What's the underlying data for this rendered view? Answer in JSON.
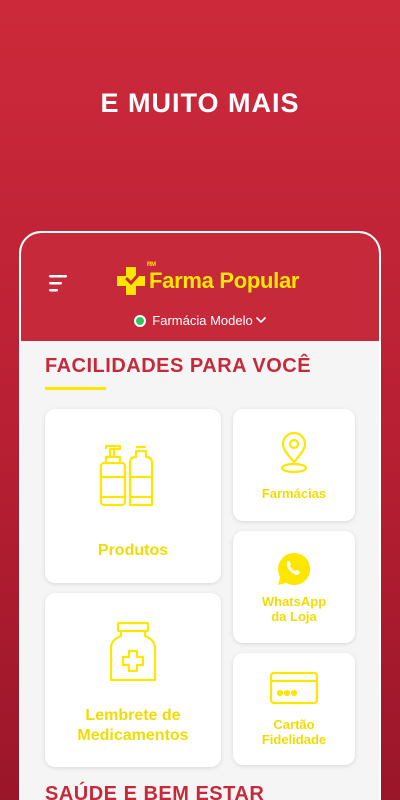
{
  "hero": {
    "title": "E MUITO MAIS"
  },
  "header": {
    "logo_rm": "RM",
    "logo_text": "Farma Popular",
    "store_name": "Farmácia Modelo"
  },
  "sections": [
    {
      "title": "FACILIDADES PARA VOCÊ"
    },
    {
      "title": "SAÚDE E BEM ESTAR"
    }
  ],
  "cards": {
    "produtos": {
      "label": "Produtos",
      "icon": "bottles-icon"
    },
    "farmacias": {
      "label": "Farmácias",
      "icon": "location-pin-icon"
    },
    "whatsapp": {
      "label_line1": "WhatsApp",
      "label_line2": "da Loja",
      "icon": "whatsapp-icon"
    },
    "lembrete": {
      "label_line1": "Lembrete de",
      "label_line2": "Medicamentos",
      "icon": "medicine-jar-icon"
    },
    "cartao": {
      "label_line1": "Cartão",
      "label_line2": "Fidelidade",
      "icon": "card-icon"
    }
  },
  "colors": {
    "brand_red": "#c62a3a",
    "brand_yellow": "#ffe600",
    "status_green": "#32c55a"
  }
}
